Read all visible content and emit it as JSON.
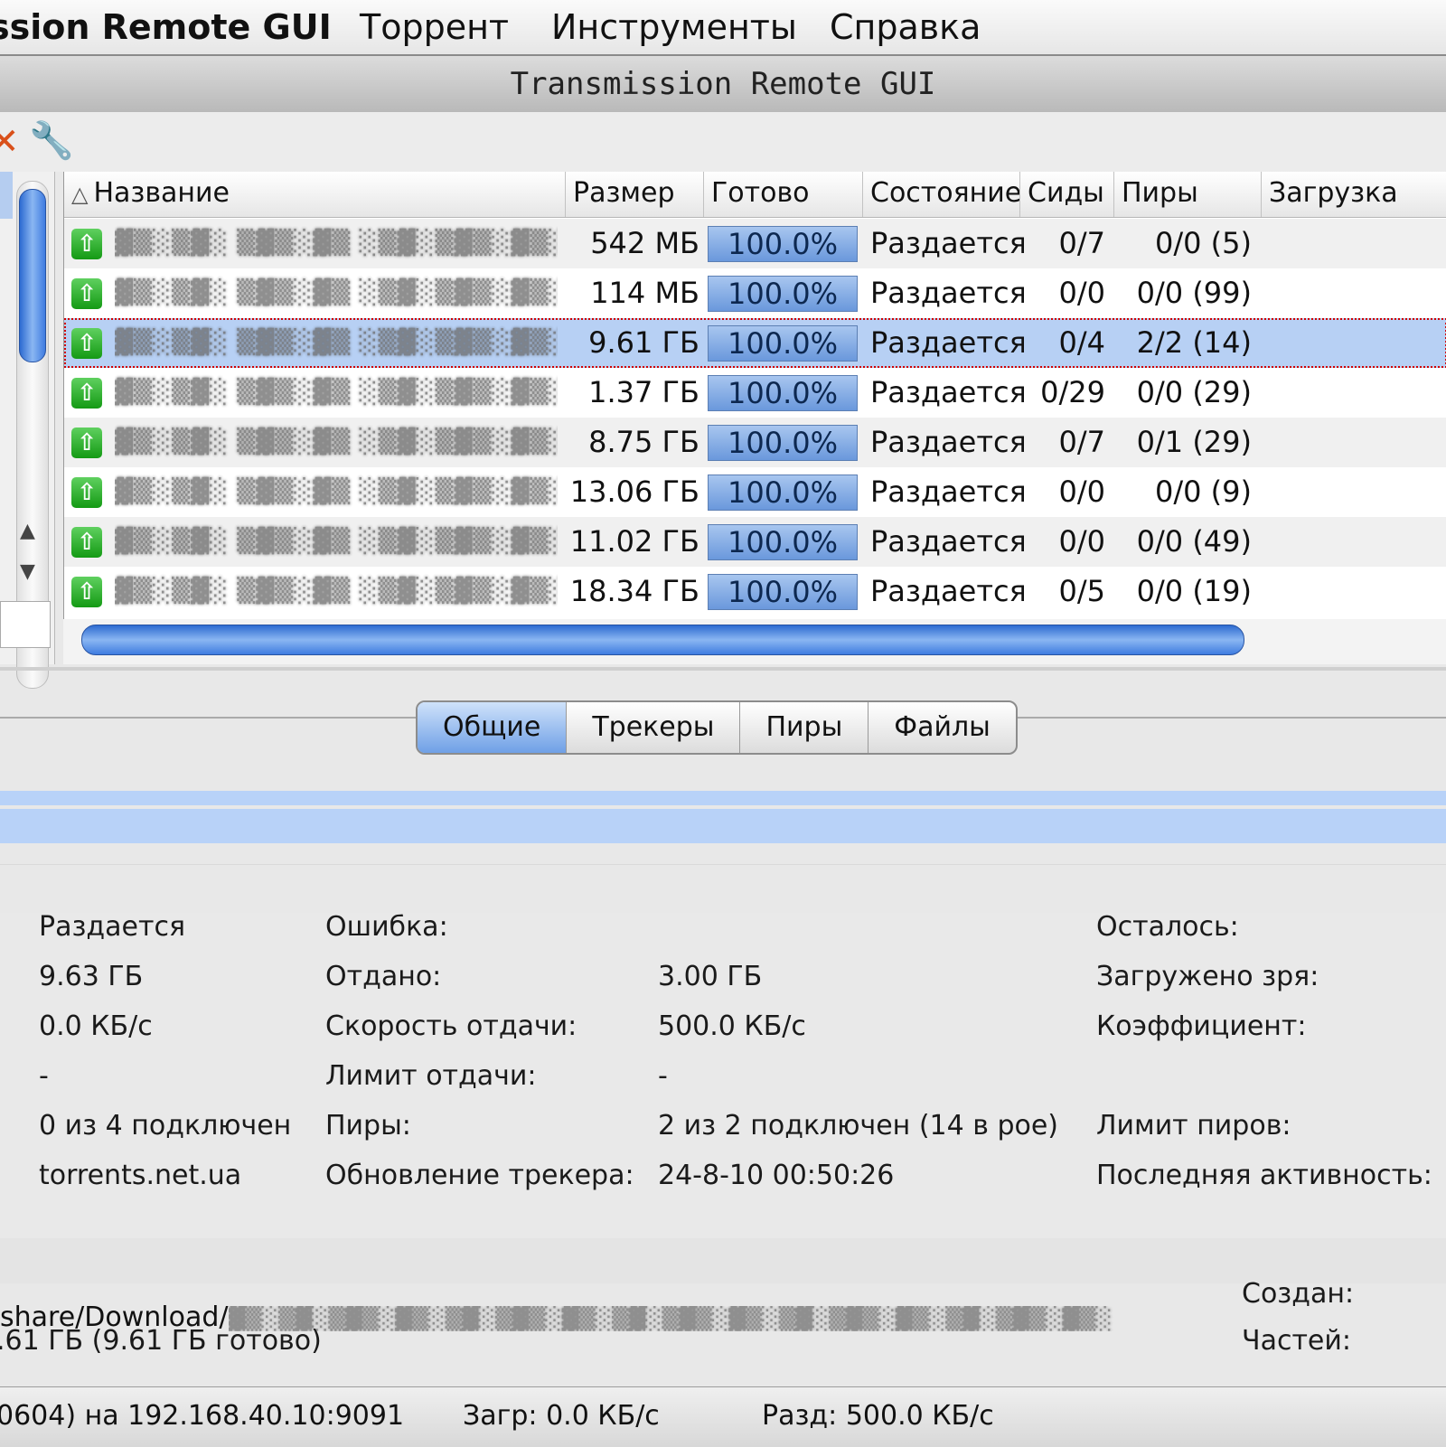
{
  "menubar": {
    "app_title": "ssion Remote GUI",
    "items": [
      "Торрент",
      "Инструменты",
      "Справка"
    ]
  },
  "window": {
    "title": "Transmission Remote GUI"
  },
  "table": {
    "columns": [
      "Название",
      "Размер",
      "Готово",
      "Состояние",
      "Сиды",
      "Пиры",
      "Загрузка"
    ],
    "rows": [
      {
        "name": "blurred-name",
        "size": "542 МБ",
        "done": "100.0%",
        "done_fraction": 1.0,
        "state": "Раздается",
        "seeds": "0/7",
        "peers": "0/0 (5)"
      },
      {
        "name": "blurred-name",
        "size": "114 МБ",
        "done": "100.0%",
        "done_fraction": 1.0,
        "state": "Раздается",
        "seeds": "0/0",
        "peers": "0/0 (99)"
      },
      {
        "name": "blurred-name",
        "size": "9.61 ГБ",
        "done": "100.0%",
        "done_fraction": 1.0,
        "state": "Раздается",
        "seeds": "0/4",
        "peers": "2/2 (14)"
      },
      {
        "name": "blurred-name",
        "size": "1.37 ГБ",
        "done": "100.0%",
        "done_fraction": 1.0,
        "state": "Раздается",
        "seeds": "0/29",
        "peers": "0/0 (29)"
      },
      {
        "name": "blurred-name",
        "size": "8.75 ГБ",
        "done": "100.0%",
        "done_fraction": 1.0,
        "state": "Раздается",
        "seeds": "0/7",
        "peers": "0/1 (29)"
      },
      {
        "name": "blurred-name",
        "size": "13.06 ГБ",
        "done": "100.0%",
        "done_fraction": 1.0,
        "state": "Раздается",
        "seeds": "0/0",
        "peers": "0/0 (9)"
      },
      {
        "name": "blurred-name",
        "size": "11.02 ГБ",
        "done": "100.0%",
        "done_fraction": 1.0,
        "state": "Раздается",
        "seeds": "0/0",
        "peers": "0/0 (49)"
      },
      {
        "name": "blurred-name",
        "size": "18.34 ГБ",
        "done": "100.0%",
        "done_fraction": 1.0,
        "state": "Раздается",
        "seeds": "0/5",
        "peers": "0/0 (19)"
      }
    ],
    "selected_row": 2
  },
  "tabs": [
    "Общие",
    "Трекеры",
    "Пиры",
    "Файлы"
  ],
  "active_tab": "Общие",
  "info": {
    "col1": [
      "Раздается",
      "9.63 ГБ",
      "0.0 КБ/с",
      "-",
      "0 из 4 подключен",
      "torrents.net.ua"
    ],
    "labels": [
      "Ошибка:",
      "Отдано:",
      "Скорость отдачи:",
      "Лимит отдачи:",
      "Пиры:",
      "Обновление трекера:"
    ],
    "values": [
      "",
      "3.00 ГБ",
      "500.0 КБ/с",
      "-",
      "2 из 2 подключен (14 в рое)",
      "24-8-10 00:50:26"
    ],
    "right_labels": [
      "Осталось:",
      "Загружено зря:",
      "Коэффициент:",
      "",
      "Лимит пиров:",
      "Последняя активность:"
    ]
  },
  "details": {
    "path_prefix": "share/Download/",
    "created_label": "Создан:",
    "size_line": ".61 ГБ (9.61 ГБ готово)",
    "pieces_label": "Частей:"
  },
  "status": {
    "host": "0604) на 192.168.40.10:9091",
    "down": "Загр: 0.0 КБ/с",
    "up": "Разд: 500.0 КБ/с"
  },
  "icons": {
    "row": "seeding-up-arrow-icon",
    "toolbar": [
      "delete-icon",
      "wrench-icon"
    ]
  }
}
